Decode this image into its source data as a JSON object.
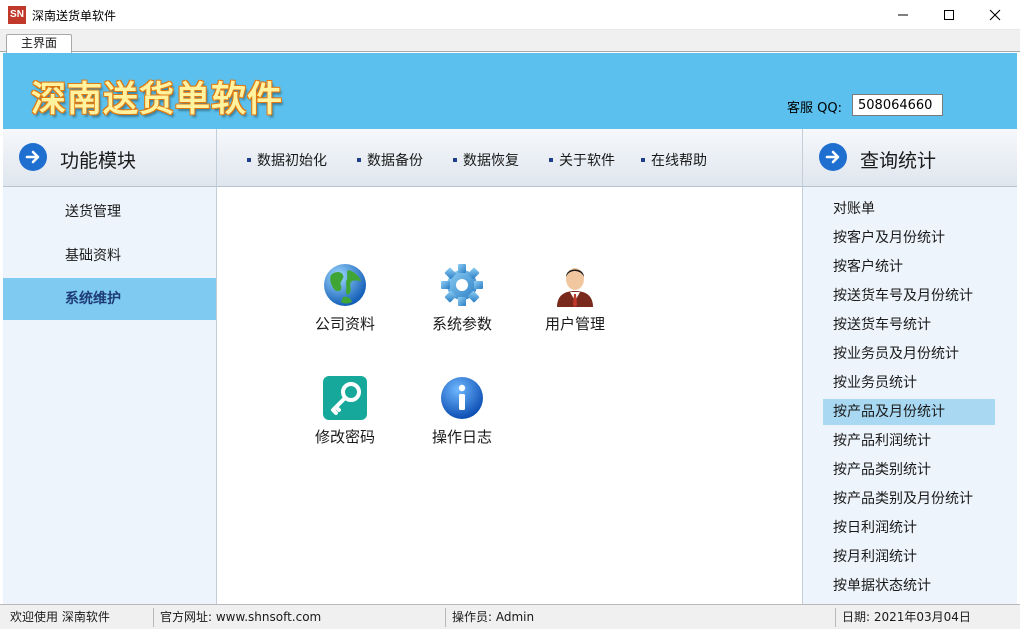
{
  "window": {
    "icon_text": "SN",
    "title": "深南送货单软件"
  },
  "tabs": [
    {
      "label": "主界面"
    }
  ],
  "banner": {
    "title": "深南送货单软件",
    "qq_label": "客服 QQ:",
    "qq_value": "508064660"
  },
  "left_panel": {
    "header": "功能模块",
    "items": [
      {
        "label": "送货管理"
      },
      {
        "label": "基础资料"
      },
      {
        "label": "系统维护"
      }
    ],
    "active_index": 2
  },
  "toolbar": {
    "items": [
      {
        "label": "数据初始化"
      },
      {
        "label": "数据备份"
      },
      {
        "label": "数据恢复"
      },
      {
        "label": "关于软件"
      },
      {
        "label": "在线帮助"
      }
    ]
  },
  "modules": [
    {
      "label": "公司资料",
      "icon": "globe-icon"
    },
    {
      "label": "系统参数",
      "icon": "gear-icon"
    },
    {
      "label": "用户管理",
      "icon": "user-icon"
    },
    {
      "label": "修改密码",
      "icon": "key-icon"
    },
    {
      "label": "操作日志",
      "icon": "info-icon"
    }
  ],
  "right_panel": {
    "header": "查询统计",
    "items": [
      {
        "label": "对账单"
      },
      {
        "label": "按客户及月份统计"
      },
      {
        "label": "按客户统计"
      },
      {
        "label": "按送货车号及月份统计"
      },
      {
        "label": "按送货车号统计"
      },
      {
        "label": "按业务员及月份统计"
      },
      {
        "label": "按业务员统计"
      },
      {
        "label": "按产品及月份统计"
      },
      {
        "label": "按产品利润统计"
      },
      {
        "label": "按产品类别统计"
      },
      {
        "label": "按产品类别及月份统计"
      },
      {
        "label": "按日利润统计"
      },
      {
        "label": "按月利润统计"
      },
      {
        "label": "按单据状态统计"
      }
    ],
    "active_index": 7
  },
  "statusbar": {
    "welcome": "欢迎使用 深南软件",
    "website": "官方网址: www.shnsoft.com",
    "operator": "操作员: Admin",
    "date": "日期: 2021年03月04日"
  },
  "colors": {
    "banner": "#5bc0ed",
    "active_nav": "#7fcaf0",
    "active_list": "#a9d8f2",
    "accent": "#1f6fd1"
  }
}
